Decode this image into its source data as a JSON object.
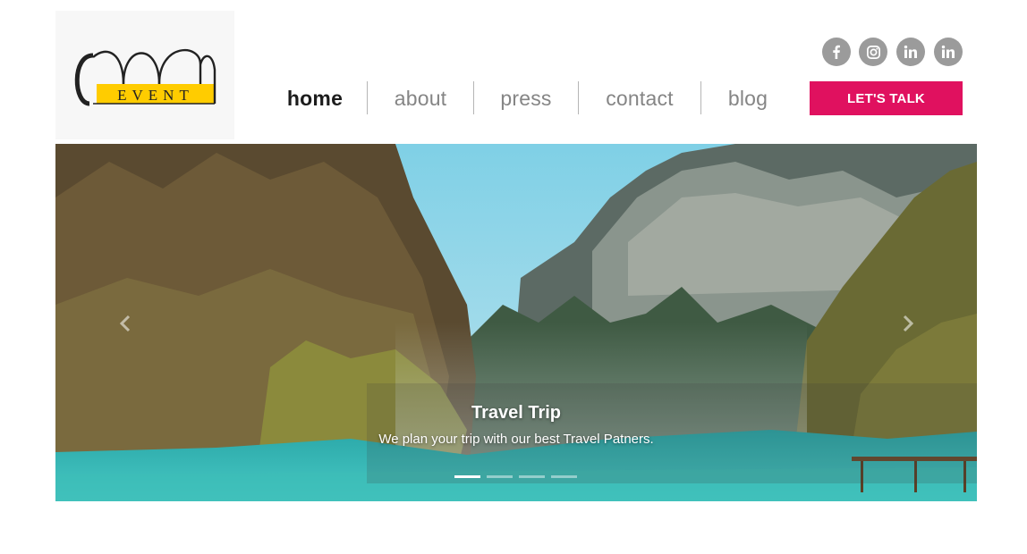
{
  "logo": {
    "text": "EVENT",
    "accent": "#ffcc00"
  },
  "social": [
    {
      "icon": "facebook-icon"
    },
    {
      "icon": "instagram-icon"
    },
    {
      "icon": "linkedin-icon"
    },
    {
      "icon": "linkedin-icon"
    }
  ],
  "nav": {
    "items": [
      {
        "label": "home",
        "active": true
      },
      {
        "label": "about",
        "active": false
      },
      {
        "label": "press",
        "active": false
      },
      {
        "label": "contact",
        "active": false
      },
      {
        "label": "blog",
        "active": false
      }
    ],
    "cta_label": "LET'S TALK"
  },
  "hero": {
    "title": "Travel Trip",
    "text": "We plan your trip with our best Travel Patners.",
    "slide_count": 4,
    "active_slide": 1
  },
  "colors": {
    "accent": "#e0115f",
    "social": "#9b9b9b",
    "nav_active": "#1c1c1c",
    "nav_inactive": "#858585"
  }
}
